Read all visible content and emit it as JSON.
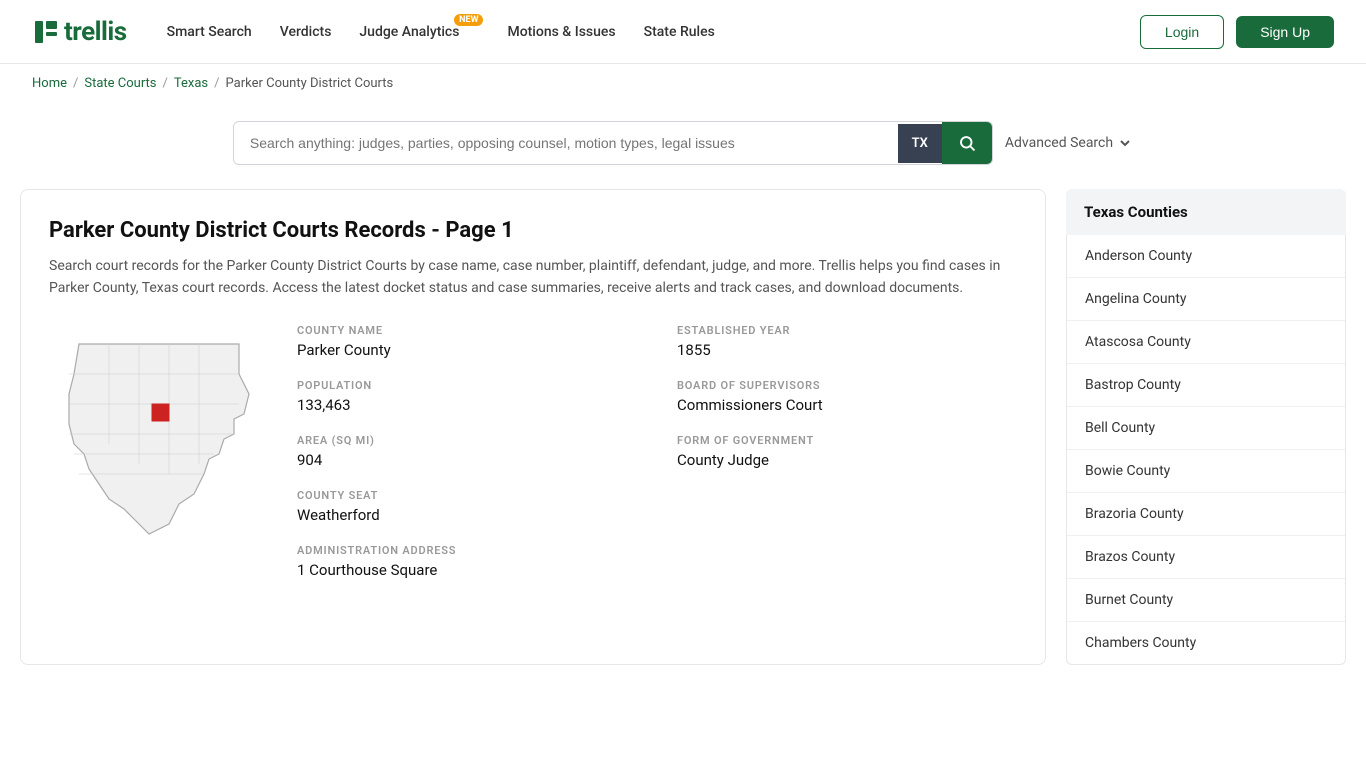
{
  "header": {
    "logo_text": "trellis",
    "nav": [
      {
        "label": "Smart Search",
        "badge": null
      },
      {
        "label": "Verdicts",
        "badge": null
      },
      {
        "label": "Judge Analytics",
        "badge": "NEW"
      },
      {
        "label": "Motions & Issues",
        "badge": null
      },
      {
        "label": "State Rules",
        "badge": null
      }
    ],
    "login_label": "Login",
    "signup_label": "Sign Up"
  },
  "breadcrumb": {
    "home": "Home",
    "state_courts": "State Courts",
    "texas": "Texas",
    "current": "Parker County District Courts"
  },
  "search": {
    "placeholder": "Search anything: judges, parties, opposing counsel, motion types, legal issues",
    "state": "TX",
    "advanced_label": "Advanced Search"
  },
  "content": {
    "title": "Parker County District Courts Records - Page 1",
    "description": "Search court records for the Parker County District Courts by case name, case number, plaintiff, defendant, judge, and more. Trellis helps you find cases in Parker County, Texas court records. Access the latest docket status and case summaries, receive alerts and track cases, and download documents.",
    "county_name_label": "COUNTY NAME",
    "county_name_value": "Parker County",
    "established_year_label": "ESTABLISHED YEAR",
    "established_year_value": "1855",
    "population_label": "POPULATION",
    "population_value": "133,463",
    "board_of_supervisors_label": "BOARD OF SUPERVISORS",
    "board_of_supervisors_value": "Commissioners Court",
    "area_label": "AREA (SQ MI)",
    "area_value": "904",
    "form_of_government_label": "FORM OF GOVERNMENT",
    "form_of_government_value": "County Judge",
    "county_seat_label": "COUNTY SEAT",
    "county_seat_value": "Weatherford",
    "administration_address_label": "ADMINISTRATION ADDRESS",
    "administration_address_value": "1 Courthouse Square"
  },
  "sidebar": {
    "section_title": "Texas Counties",
    "counties": [
      "Anderson County",
      "Angelina County",
      "Atascosa County",
      "Bastrop County",
      "Bell County",
      "Bowie County",
      "Brazoria County",
      "Brazos County",
      "Burnet County",
      "Chambers County"
    ]
  }
}
